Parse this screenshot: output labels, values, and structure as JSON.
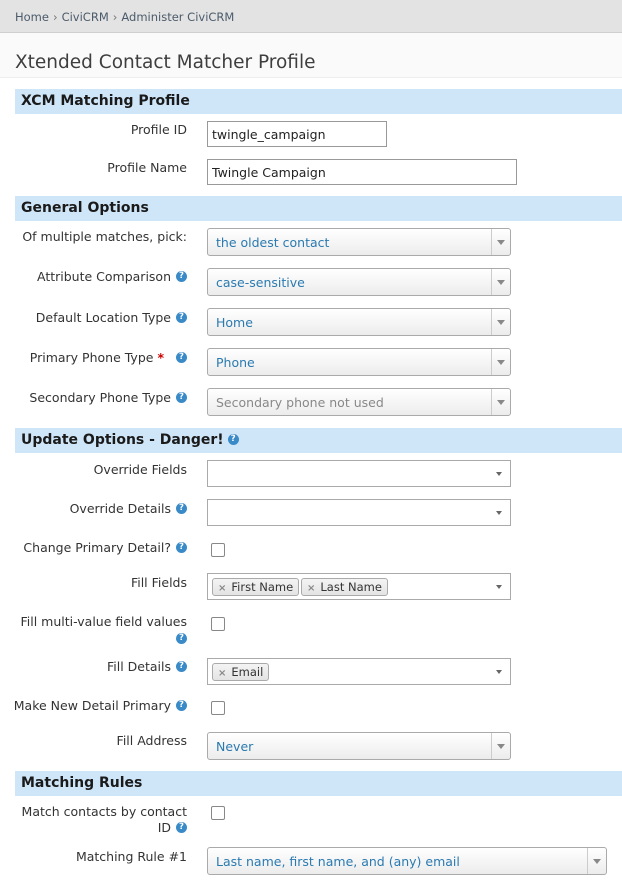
{
  "breadcrumb": [
    "Home",
    "CiviCRM",
    "Administer CiviCRM"
  ],
  "breadcrumb_sep": "›",
  "page_title": "Xtended Contact Matcher Profile",
  "help_glyph": "?",
  "chip_remove_glyph": "×",
  "required_marker": "*",
  "sections": {
    "xcm": "XCM Matching Profile",
    "general": "General Options",
    "update": "Update Options - Danger!",
    "matching": "Matching Rules"
  },
  "fields": {
    "profile_id": {
      "label": "Profile ID",
      "value": "twingle_campaign"
    },
    "profile_name": {
      "label": "Profile Name",
      "value": "Twingle Campaign"
    },
    "multiple_matches": {
      "label": "Of multiple matches, pick:",
      "value": "the oldest contact"
    },
    "attribute_comparison": {
      "label": "Attribute Comparison",
      "value": "case-sensitive"
    },
    "default_location_type": {
      "label": "Default Location Type",
      "value": "Home"
    },
    "primary_phone_type": {
      "label": "Primary Phone Type",
      "value": "Phone"
    },
    "secondary_phone_type": {
      "label": "Secondary Phone Type",
      "placeholder": "Secondary phone not used"
    },
    "override_fields": {
      "label": "Override Fields"
    },
    "override_details": {
      "label": "Override Details"
    },
    "change_primary_detail": {
      "label": "Change Primary Detail?",
      "checked": false
    },
    "fill_fields": {
      "label": "Fill Fields",
      "chips": [
        "First Name",
        "Last Name"
      ]
    },
    "fill_multi_value": {
      "label": "Fill multi-value field values",
      "checked": false
    },
    "fill_details": {
      "label": "Fill Details",
      "chips": [
        "Email"
      ]
    },
    "make_new_detail_primary": {
      "label": "Make New Detail Primary",
      "checked": false
    },
    "fill_address": {
      "label": "Fill Address",
      "value": "Never"
    },
    "match_by_contact_id": {
      "label_line1": "Match contacts by contact",
      "label_line2": "ID",
      "checked": false
    },
    "matching_rule_1": {
      "label": "Matching Rule #1",
      "value": "Last name, first name, and (any) email"
    }
  }
}
